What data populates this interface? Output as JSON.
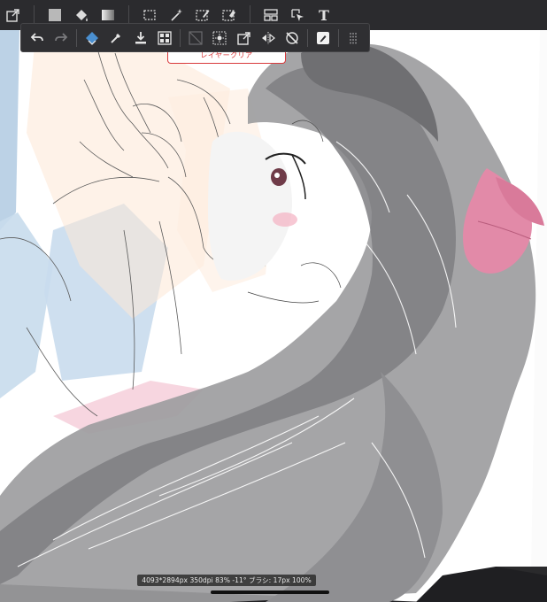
{
  "icons": {
    "topbar": [
      "export-icon",
      "color-square-icon",
      "fill-bucket-icon",
      "gradient-icon",
      "marquee-select-icon",
      "magic-wand-icon",
      "pen-select-icon",
      "select-eraser-icon",
      "layout-panel-icon",
      "move-select-icon",
      "text-tool-icon"
    ],
    "subbar": [
      "undo-icon",
      "redo-icon",
      "layer-transform-icon",
      "eyedropper-icon",
      "download-layer-icon",
      "grid-icon",
      "diagonal-icon",
      "brightness-icon",
      "external-icon",
      "flip-icon",
      "no-rotate-icon",
      "edit-square-icon",
      "more-dots-icon"
    ]
  },
  "topbar": {
    "text_tool_glyph": "T"
  },
  "popup": {
    "label": "レイヤークリア"
  },
  "status": {
    "text": "4093*2894px 350dpi 83% -11° ブラシ: 17px 100%"
  },
  "colors": {
    "toolbar_bg": "#2b2b2e",
    "accent_red": "#d8393b",
    "ribbon_pink": "#e28aa8"
  }
}
